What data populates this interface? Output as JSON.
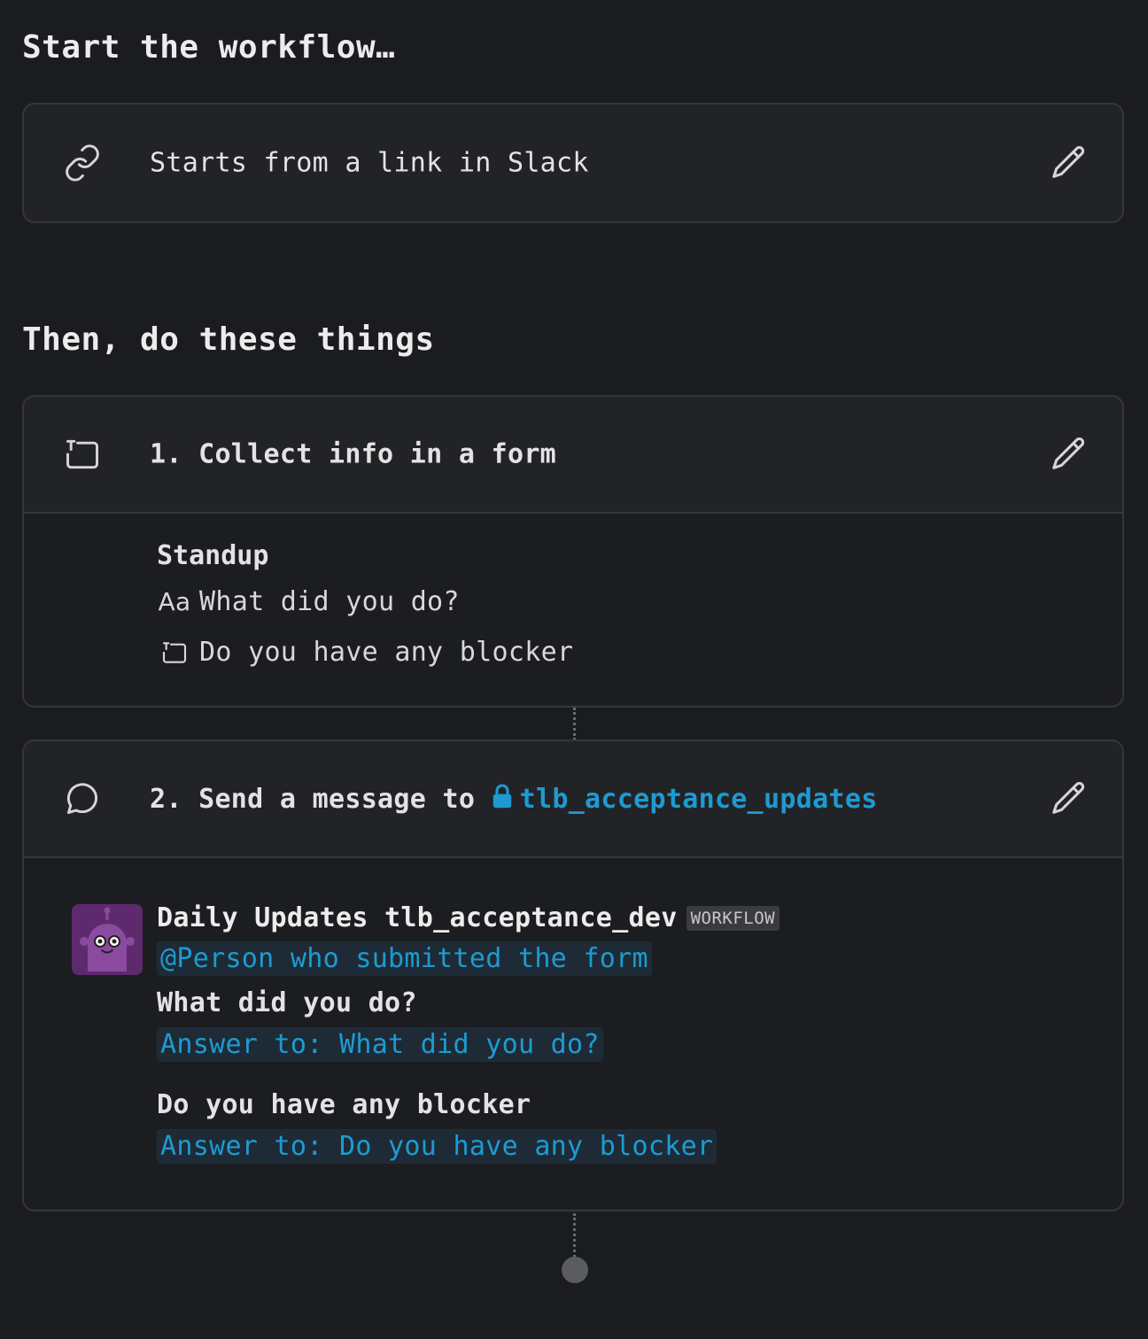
{
  "trigger_section": {
    "title": "Start the workflow…",
    "trigger": {
      "icon": "link-icon",
      "label": "Starts from a link in Slack",
      "edit_icon": "pencil-icon"
    }
  },
  "steps_section": {
    "title": "Then, do these things",
    "steps": [
      {
        "icon": "form-icon",
        "label": "1. Collect info in a form",
        "edit_icon": "pencil-icon",
        "form": {
          "title": "Standup",
          "fields": [
            {
              "icon": "short-text-icon",
              "icon_glyph": "Aa",
              "label": "What did you do?"
            },
            {
              "icon": "form-icon",
              "label": "Do you have any blocker"
            }
          ]
        }
      },
      {
        "icon": "message-bubble-icon",
        "label_prefix": "2. Send a message to",
        "channel_icon": "lock-icon",
        "channel": "tlb_acceptance_updates",
        "edit_icon": "pencil-icon",
        "message": {
          "avatar_icon": "robot-avatar-icon",
          "sender": "Daily Updates tlb_acceptance_dev",
          "badge": "WORKFLOW",
          "mention": "@Person who submitted the form",
          "q1_label": "What did you do?",
          "q1_answer": "Answer to: What did you do?",
          "q2_label": "Do you have any blocker",
          "q2_answer": "Answer to: Do you have any blocker"
        }
      }
    ]
  },
  "colors": {
    "background": "#1b1c20",
    "card": "#222327",
    "border": "#35363b",
    "accent": "#1d9bd1",
    "avatar": "#5e2a6e",
    "token_bg": "#1e2b37"
  }
}
